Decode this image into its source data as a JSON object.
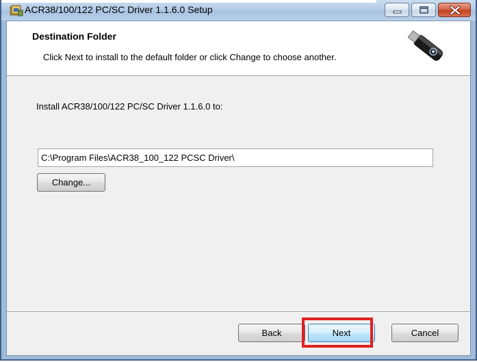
{
  "window": {
    "title": "ACR38/100/122 PC/SC Driver 1.1.6.0 Setup",
    "icon": "installer-icon",
    "controls": [
      "minimize-icon",
      "maximize-icon",
      "close-icon"
    ]
  },
  "header": {
    "title": "Destination Folder",
    "subtitle": "Click Next to install to the default folder or click Change to choose another.",
    "logo": "usb-token-logo"
  },
  "main": {
    "install_label": "Install ACR38/100/122 PC/SC Driver 1.1.6.0 to:",
    "path_value": "C:\\Program Files\\ACR38_100_122 PCSC Driver\\",
    "change_label": "Change..."
  },
  "footer": {
    "back_label": "Back",
    "next_label": "Next",
    "cancel_label": "Cancel"
  },
  "colors": {
    "highlight": "#e0211f",
    "close_button": "#c4401e"
  }
}
